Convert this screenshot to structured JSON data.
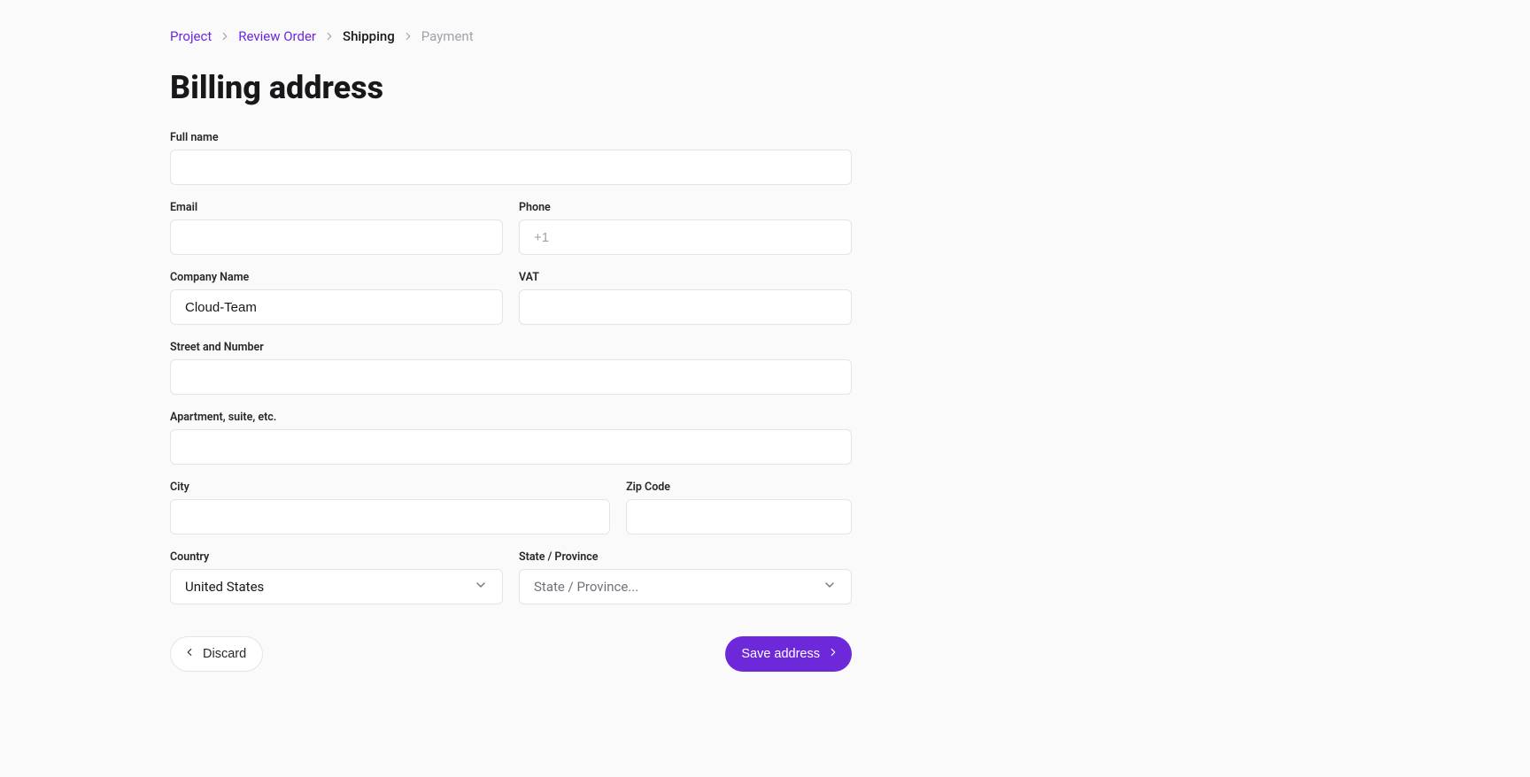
{
  "breadcrumb": {
    "project": "Project",
    "review_order": "Review Order",
    "shipping": "Shipping",
    "payment": "Payment"
  },
  "page": {
    "title": "Billing address"
  },
  "form": {
    "full_name": {
      "label": "Full name",
      "value": ""
    },
    "email": {
      "label": "Email",
      "value": ""
    },
    "phone": {
      "label": "Phone",
      "value": "",
      "placeholder": "+1"
    },
    "company": {
      "label": "Company Name",
      "value": "Cloud-Team"
    },
    "vat": {
      "label": "VAT",
      "value": ""
    },
    "street": {
      "label": "Street and Number",
      "value": ""
    },
    "apartment": {
      "label": "Apartment, suite, etc.",
      "value": ""
    },
    "city": {
      "label": "City",
      "value": ""
    },
    "zip": {
      "label": "Zip Code",
      "value": ""
    },
    "country": {
      "label": "Country",
      "value": "United States"
    },
    "state": {
      "label": "State / Province",
      "placeholder": "State / Province..."
    }
  },
  "actions": {
    "discard": "Discard",
    "save": "Save address"
  }
}
